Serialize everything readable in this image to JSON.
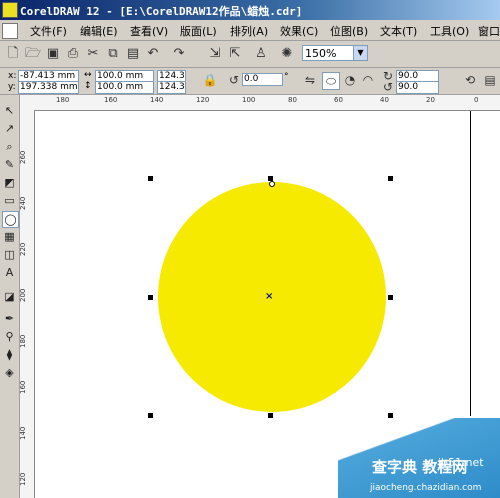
{
  "window": {
    "title": "CorelDRAW 12 - [E:\\CorelDRAW12作品\\蜡烛.cdr]"
  },
  "menu": [
    {
      "label": "文件(F)"
    },
    {
      "label": "编辑(E)"
    },
    {
      "label": "查看(V)"
    },
    {
      "label": "版面(L)"
    },
    {
      "label": "排列(A)"
    },
    {
      "label": "效果(C)"
    },
    {
      "label": "位图(B)"
    },
    {
      "label": "文本(T)"
    },
    {
      "label": "工具(O)"
    },
    {
      "label": "窗口"
    }
  ],
  "toolbar": {
    "zoom": "150%"
  },
  "properties": {
    "x_label": "x:",
    "x": "-87.413 mm",
    "y_label": "y:",
    "y": "197.338 mm",
    "width": "100.0 mm",
    "height": "100.0 mm",
    "scale_x": "124.3",
    "scale_y": "124.3",
    "rotation": "0.0",
    "degree_sign": "°",
    "start_angle": "90.0",
    "end_angle": "90.0"
  },
  "ruler": {
    "h_ticks": [
      "180",
      "160",
      "140",
      "120",
      "100",
      "80",
      "60",
      "40",
      "20",
      "0"
    ],
    "v_ticks": [
      "260",
      "240",
      "220",
      "200",
      "180",
      "160",
      "140",
      "120"
    ]
  },
  "watermark": {
    "line1": "查字典 教程网",
    "line2": "jb51.net",
    "line3": "jiaocheng.chazidian.com"
  },
  "colors": {
    "fill": "#f5ea00",
    "accent": "#0a246a"
  }
}
